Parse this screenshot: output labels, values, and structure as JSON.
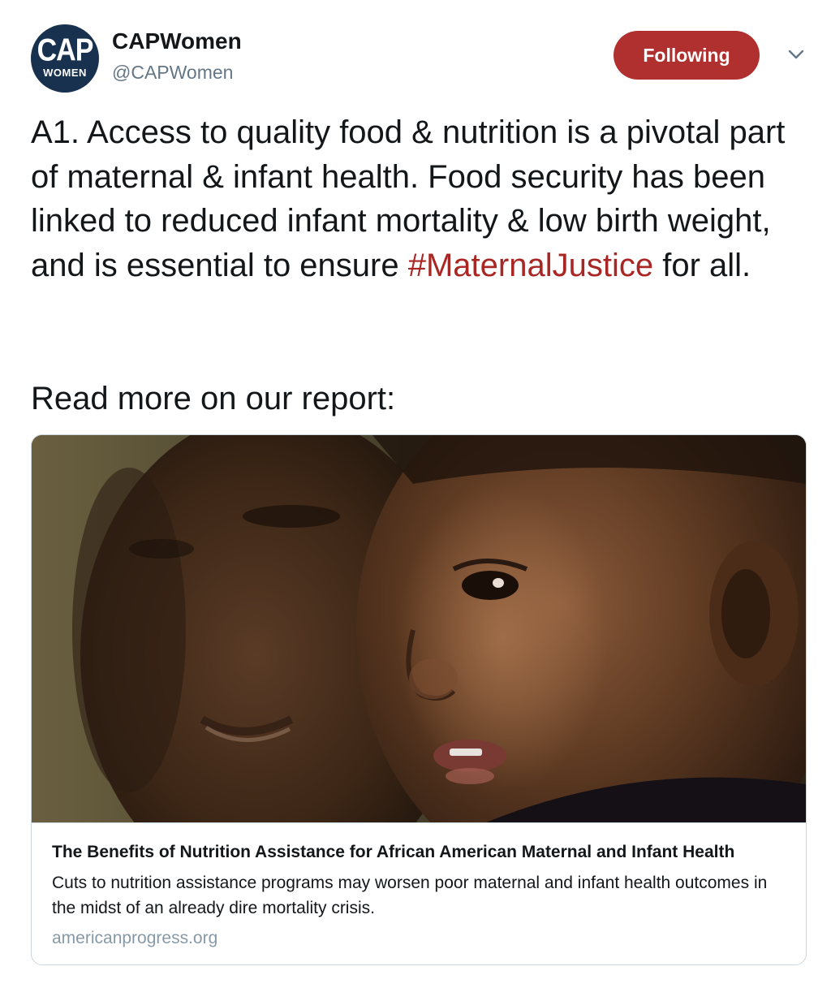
{
  "author": {
    "avatar_text_top": "CAP",
    "avatar_text_bottom": "WOMEN",
    "display_name": "CAPWomen",
    "handle": "@CAPWomen"
  },
  "actions": {
    "follow_label": "Following",
    "menu_icon": "chevron-down-icon"
  },
  "tweet": {
    "text_before_hashtag": "A1. Access to quality food & nutrition is a pivotal part of maternal & infant health. Food security has been linked to reduced infant mortality & low birth weight, and is essential to ensure ",
    "hashtag": "#MaternalJustice",
    "text_after_hashtag": " for all.",
    "read_more": "Read more on our report:"
  },
  "card": {
    "title": "The Benefits of Nutrition Assistance for African American Maternal and Infant Health",
    "description": "Cuts to nutrition assistance programs may worsen poor maternal and infant health outcomes in the midst of an already dire mortality crisis.",
    "domain": "americanprogress.org"
  },
  "colors": {
    "follow_button": "#b0302f",
    "hashtag": "#a82623",
    "avatar_bg": "#18314f",
    "secondary_text": "#657786",
    "card_border": "#ccd6dd"
  }
}
